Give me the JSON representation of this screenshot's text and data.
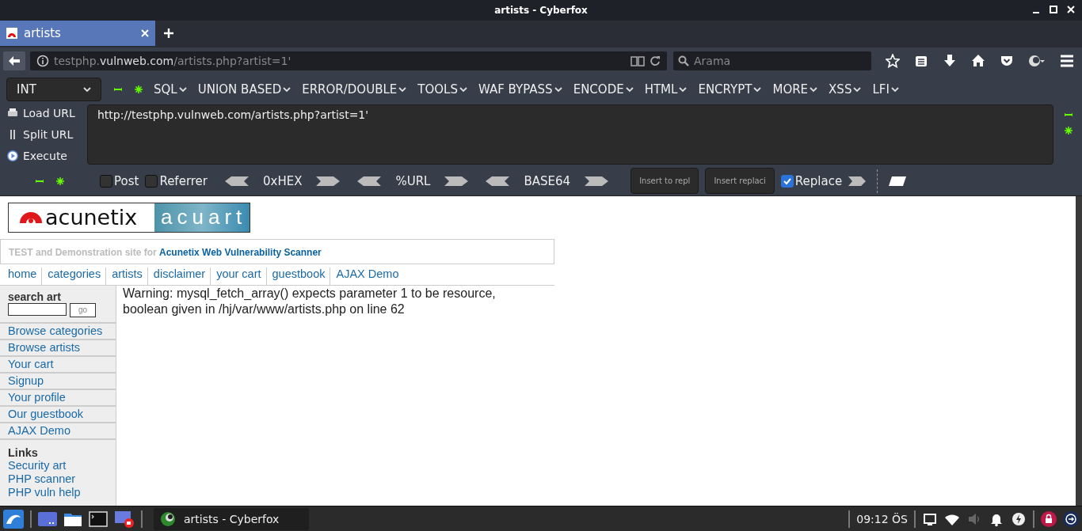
{
  "window": {
    "title": "artists - Cyberfox"
  },
  "tabs": [
    {
      "label": "artists",
      "selected": true
    }
  ],
  "url_bar": {
    "host_prefix": "testphp.",
    "host": "vulnweb.com",
    "path": "/artists.php?artist=1'"
  },
  "search": {
    "placeholder": "Arama"
  },
  "hackbar": {
    "type_select": "INT",
    "menus": [
      "SQL",
      "UNION BASED",
      "ERROR/DOUBLE",
      "TOOLS",
      "WAF BYPASS",
      "ENCODE",
      "HTML",
      "ENCRYPT",
      "MORE",
      "XSS",
      "LFI"
    ],
    "actions": [
      "Load URL",
      "Split URL",
      "Execute"
    ],
    "url_text": "http://testphp.vulnweb.com/artists.php?artist=1'",
    "options": [
      {
        "label": "Post",
        "checked": false
      },
      {
        "label": "Referrer",
        "checked": false
      }
    ],
    "encoders": [
      "0xHEX",
      "%URL",
      "BASE64"
    ],
    "insert_buttons": [
      "Insert to repl",
      "Insert replaci"
    ],
    "replace": {
      "label": "Replace",
      "checked": true
    }
  },
  "page": {
    "logo_text": "acunetix",
    "logo_art": "acuart",
    "tagline": "TEST and Demonstration site for **Acunetix Web Vulnerability Scanner**",
    "nav": [
      "home",
      "categories",
      "artists",
      "disclaimer",
      "your cart",
      "guestbook",
      "AJAX Demo"
    ],
    "search_heading": "search art",
    "search_button": "go",
    "sidebar_links": [
      "Browse categories",
      "Browse artists",
      "Your cart",
      "Signup",
      "Your profile",
      "Our guestbook",
      "AJAX Demo"
    ],
    "links_heading": "Links",
    "links": [
      "Security art",
      "PHP scanner",
      "PHP vuln help"
    ],
    "warning": "Warning: mysql_fetch_array() expects parameter 1 to be resource, boolean given in /hj/var/www/artists.php on line 62"
  },
  "taskbar": {
    "task": "artists - Cyberfox",
    "clock": "09:12 ÖS"
  }
}
